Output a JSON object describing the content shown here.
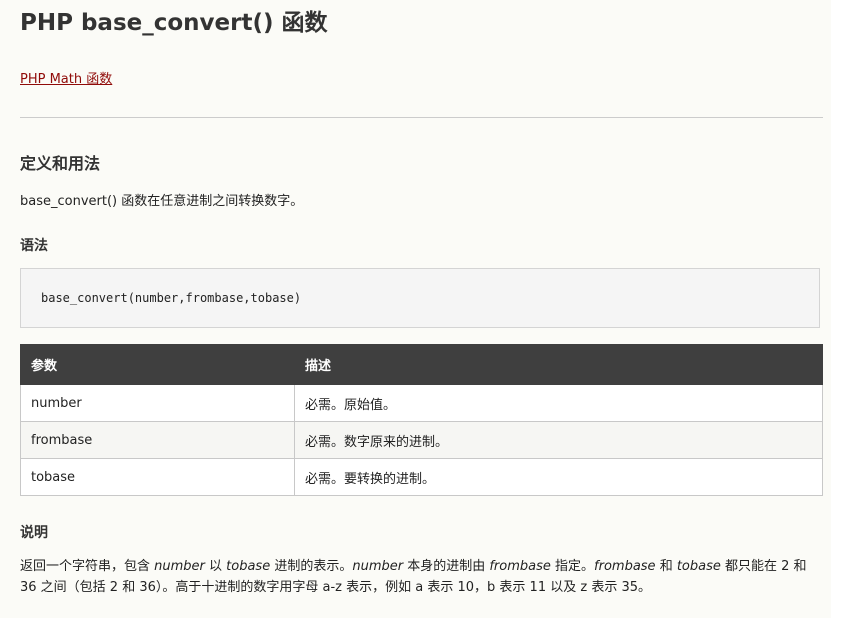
{
  "page": {
    "title": "PHP base_convert() 函数",
    "back_link": "PHP Math 函数"
  },
  "definition": {
    "heading": "定义和用法",
    "text": "base_convert() 函数在任意进制之间转换数字。"
  },
  "syntax": {
    "heading": "语法",
    "code": "base_convert(number,frombase,tobase)"
  },
  "params_table": {
    "headers": [
      "参数",
      "描述"
    ],
    "rows": [
      {
        "param": "number",
        "desc": "必需。原始值。"
      },
      {
        "param": "frombase",
        "desc": "必需。数字原来的进制。"
      },
      {
        "param": "tobase",
        "desc": "必需。要转换的进制。"
      }
    ]
  },
  "notes": {
    "heading": "说明",
    "p1_a": "返回一个字符串，包含 ",
    "p1_number": "number",
    "p1_b": " 以 ",
    "p1_tobase": "tobase",
    "p1_c": " 进制的表示。",
    "p1_number2": "number",
    "p1_d": " 本身的进制由 ",
    "p1_frombase": "frombase",
    "p1_e": " 指定。",
    "p1_frombase2": "frombase",
    "p1_f": " 和 ",
    "p1_tobase2": "tobase",
    "p1_g": " 都只能在 2 和 36 之间（包括 2 和 36）。高于十进制的数字用字母 a-z 表示，例如 a 表示 10，b 表示 11 以及 z 表示 35。"
  }
}
